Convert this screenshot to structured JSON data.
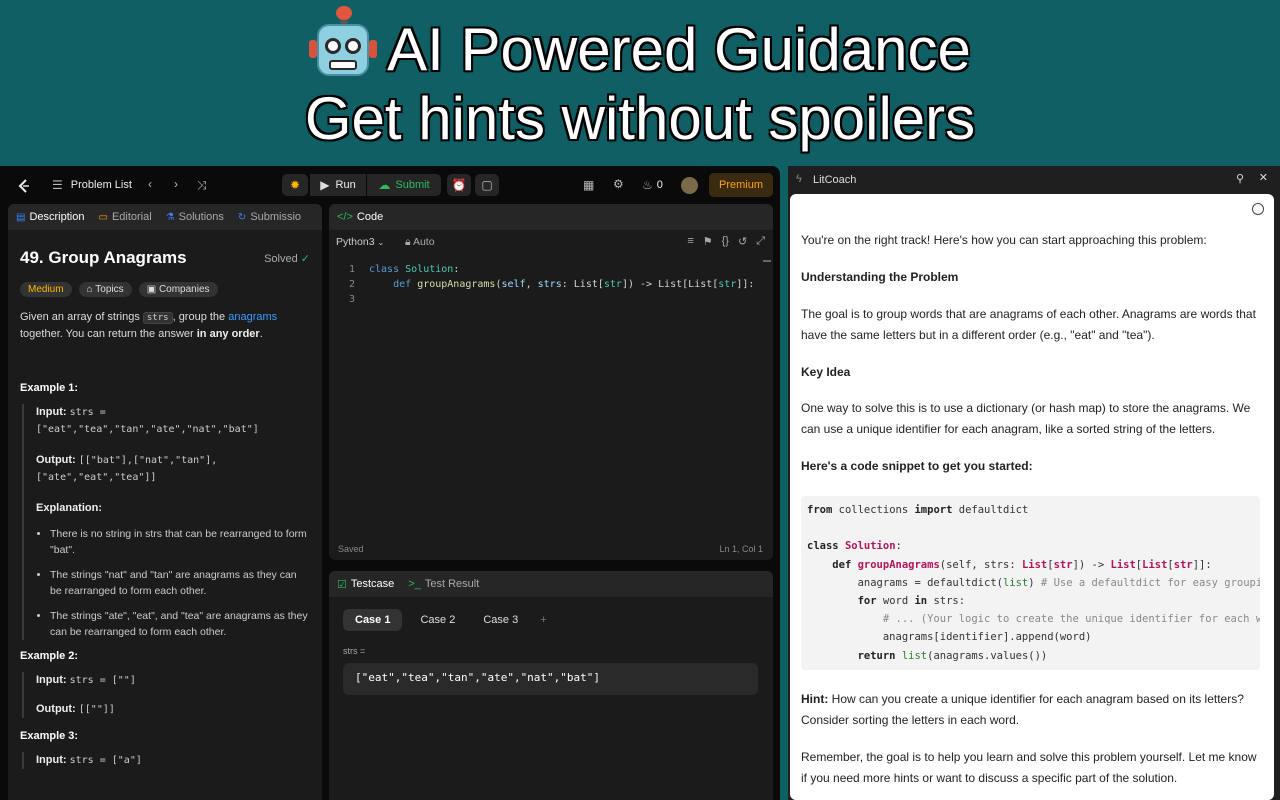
{
  "banner": {
    "line1": "AI Powered Guidance",
    "line2": "Get hints without spoilers",
    "robot_icon": "robot-icon"
  },
  "topbar": {
    "problem_list": "Problem List",
    "run": "Run",
    "submit": "Submit",
    "streak": "0",
    "premium": "Premium"
  },
  "desc_tabs": [
    "Description",
    "Editorial",
    "Solutions",
    "Submissio"
  ],
  "problem": {
    "title": "49. Group Anagrams",
    "status": "Solved",
    "difficulty": "Medium",
    "topics": "Topics",
    "companies": "Companies",
    "statement_a": "Given an array of strings ",
    "statement_strs": "strs",
    "statement_b": ", group the ",
    "statement_link": "anagrams",
    "statement_c": "together. You can return the answer ",
    "statement_bold": "in any order",
    "statement_d": ".",
    "ex1_title": "Example 1:",
    "ex1_input_label": "Input:",
    "ex1_input": "strs = [\"eat\",\"tea\",\"tan\",\"ate\",\"nat\",\"bat\"]",
    "ex1_output_label": "Output:",
    "ex1_output": "[[\"bat\"],[\"nat\",\"tan\"],[\"ate\",\"eat\",\"tea\"]]",
    "explanation": "Explanation:",
    "bullets": [
      "There is no string in strs that can be rearranged to form \"bat\".",
      "The strings \"nat\" and \"tan\" are anagrams as they can be rearranged to form each other.",
      "The strings \"ate\", \"eat\", and \"tea\" are anagrams as they can be rearranged to form each other."
    ],
    "ex2_title": "Example 2:",
    "ex2_input": "strs = [\"\"]",
    "ex2_output": "[[\"\"]]",
    "ex3_title": "Example 3:",
    "ex3_input": "strs = [\"a\"]"
  },
  "code_panel": {
    "title": "Code",
    "language": "Python3",
    "auto": "Auto",
    "line_numbers": [
      "1",
      "2",
      "3"
    ],
    "saved": "Saved",
    "cursor": "Ln 1, Col 1"
  },
  "testcase": {
    "tab1": "Testcase",
    "tab2": "Test Result",
    "cases": [
      "Case 1",
      "Case 2",
      "Case 3"
    ],
    "var_label": "strs =",
    "value": "[\"eat\",\"tea\",\"tan\",\"ate\",\"nat\",\"bat\"]"
  },
  "coach": {
    "title": "LitCoach",
    "p1": "You're on the right track! Here's how you can start approaching this problem:",
    "h1": "Understanding the Problem",
    "p2": "The goal is to group words that are anagrams of each other. Anagrams are words that have the same letters but in a different order (e.g., \"eat\" and \"tea\").",
    "h2": "Key Idea",
    "p3": "One way to solve this is to use a dictionary (or hash map) to store the anagrams. We can use a unique identifier for each anagram, like a sorted string of the letters.",
    "h3": "Here's a code snippet to get you started:",
    "hint_label": "Hint:",
    "hint": " How can you create a unique identifier for each anagram based on its letters? Consider sorting the letters in each word.",
    "p4": "Remember, the goal is to help you learn and solve this problem yourself. Let me know if you need more hints or want to discuss a specific part of the solution."
  },
  "colors": {
    "banner_bg": "#0f5f64",
    "leetcode_bg": "#0a0a0a",
    "accent_orange": "#ffa116",
    "submit_green": "#2cbb5d"
  }
}
